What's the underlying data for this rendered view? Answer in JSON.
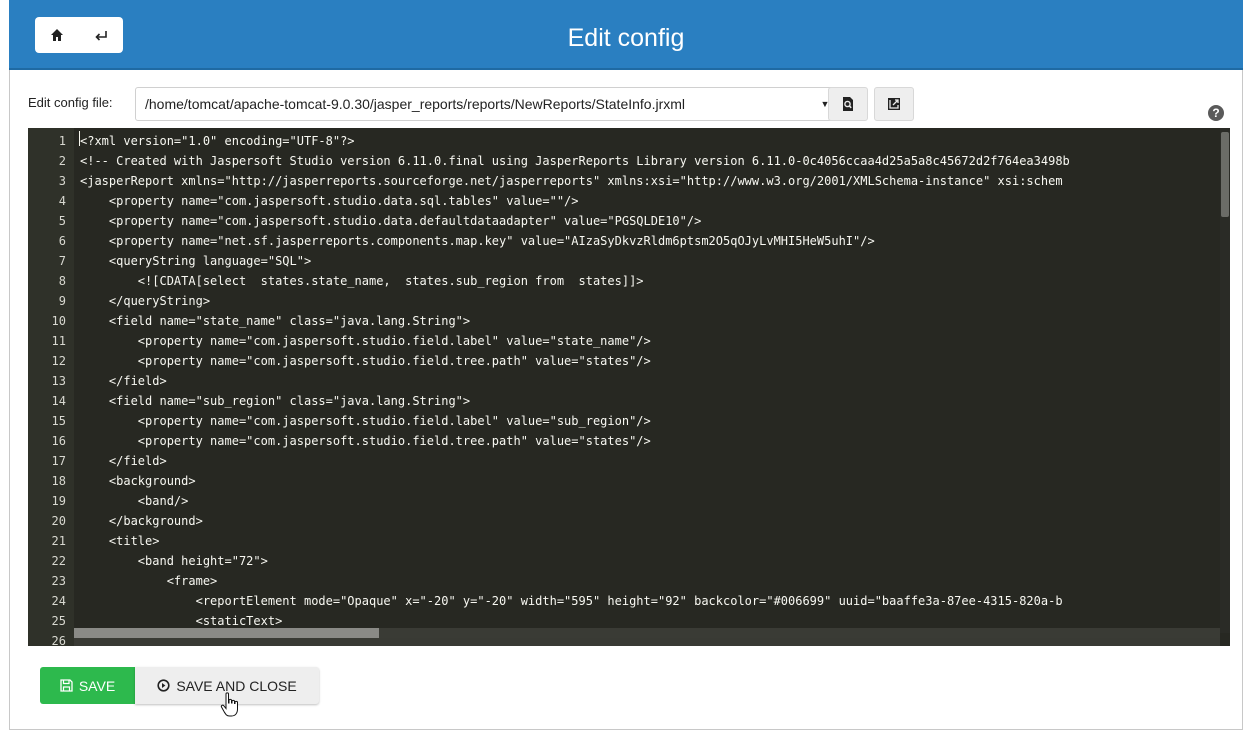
{
  "header": {
    "title": "Edit config",
    "background": "#2a7fc1",
    "home_icon": "home-icon",
    "back_icon": "return-arrow-icon"
  },
  "config": {
    "label": "Edit config file:",
    "selected_file": "/home/tomcat/apache-tomcat-9.0.30/jasper_reports/reports/NewReports/StateInfo.jrxml",
    "preview_icon": "file-search-icon",
    "open_external_icon": "external-link-icon",
    "help_icon": "?"
  },
  "editor": {
    "lines": [
      {
        "n": "1",
        "t": "<?xml version=\"1.0\" encoding=\"UTF-8\"?>"
      },
      {
        "n": "2",
        "t": "<!-- Created with Jaspersoft Studio version 6.11.0.final using JasperReports Library version 6.11.0-0c4056ccaa4d25a5a8c45672d2f764ea3498b"
      },
      {
        "n": "3",
        "t": "<jasperReport xmlns=\"http://jasperreports.sourceforge.net/jasperreports\" xmlns:xsi=\"http://www.w3.org/2001/XMLSchema-instance\" xsi:schem"
      },
      {
        "n": "4",
        "t": "    <property name=\"com.jaspersoft.studio.data.sql.tables\" value=\"\"/>"
      },
      {
        "n": "5",
        "t": "    <property name=\"com.jaspersoft.studio.data.defaultdataadapter\" value=\"PGSQLDE10\"/>"
      },
      {
        "n": "6",
        "t": "    <property name=\"net.sf.jasperreports.components.map.key\" value=\"AIzaSyDkvzRldm6ptsm2O5qOJyLvMHI5HeW5uhI\"/>"
      },
      {
        "n": "7",
        "t": "    <queryString language=\"SQL\">"
      },
      {
        "n": "8",
        "t": "        <![CDATA[select  states.state_name,  states.sub_region from  states]]>"
      },
      {
        "n": "9",
        "t": "    </queryString>"
      },
      {
        "n": "10",
        "t": "    <field name=\"state_name\" class=\"java.lang.String\">"
      },
      {
        "n": "11",
        "t": "        <property name=\"com.jaspersoft.studio.field.label\" value=\"state_name\"/>"
      },
      {
        "n": "12",
        "t": "        <property name=\"com.jaspersoft.studio.field.tree.path\" value=\"states\"/>"
      },
      {
        "n": "13",
        "t": "    </field>"
      },
      {
        "n": "14",
        "t": "    <field name=\"sub_region\" class=\"java.lang.String\">"
      },
      {
        "n": "15",
        "t": "        <property name=\"com.jaspersoft.studio.field.label\" value=\"sub_region\"/>"
      },
      {
        "n": "16",
        "t": "        <property name=\"com.jaspersoft.studio.field.tree.path\" value=\"states\"/>"
      },
      {
        "n": "17",
        "t": "    </field>"
      },
      {
        "n": "18",
        "t": "    <background>"
      },
      {
        "n": "19",
        "t": "        <band/>"
      },
      {
        "n": "20",
        "t": "    </background>"
      },
      {
        "n": "21",
        "t": "    <title>"
      },
      {
        "n": "22",
        "t": "        <band height=\"72\">"
      },
      {
        "n": "23",
        "t": "            <frame>"
      },
      {
        "n": "24",
        "t": "                <reportElement mode=\"Opaque\" x=\"-20\" y=\"-20\" width=\"595\" height=\"92\" backcolor=\"#006699\" uuid=\"baaffe3a-87ee-4315-820a-b"
      },
      {
        "n": "25",
        "t": "                <staticText>"
      },
      {
        "n": "26",
        "t": ""
      }
    ]
  },
  "actions": {
    "save_label": "SAVE",
    "save_color": "#2db94d",
    "save_and_close_label": "SAVE AND CLOSE"
  }
}
